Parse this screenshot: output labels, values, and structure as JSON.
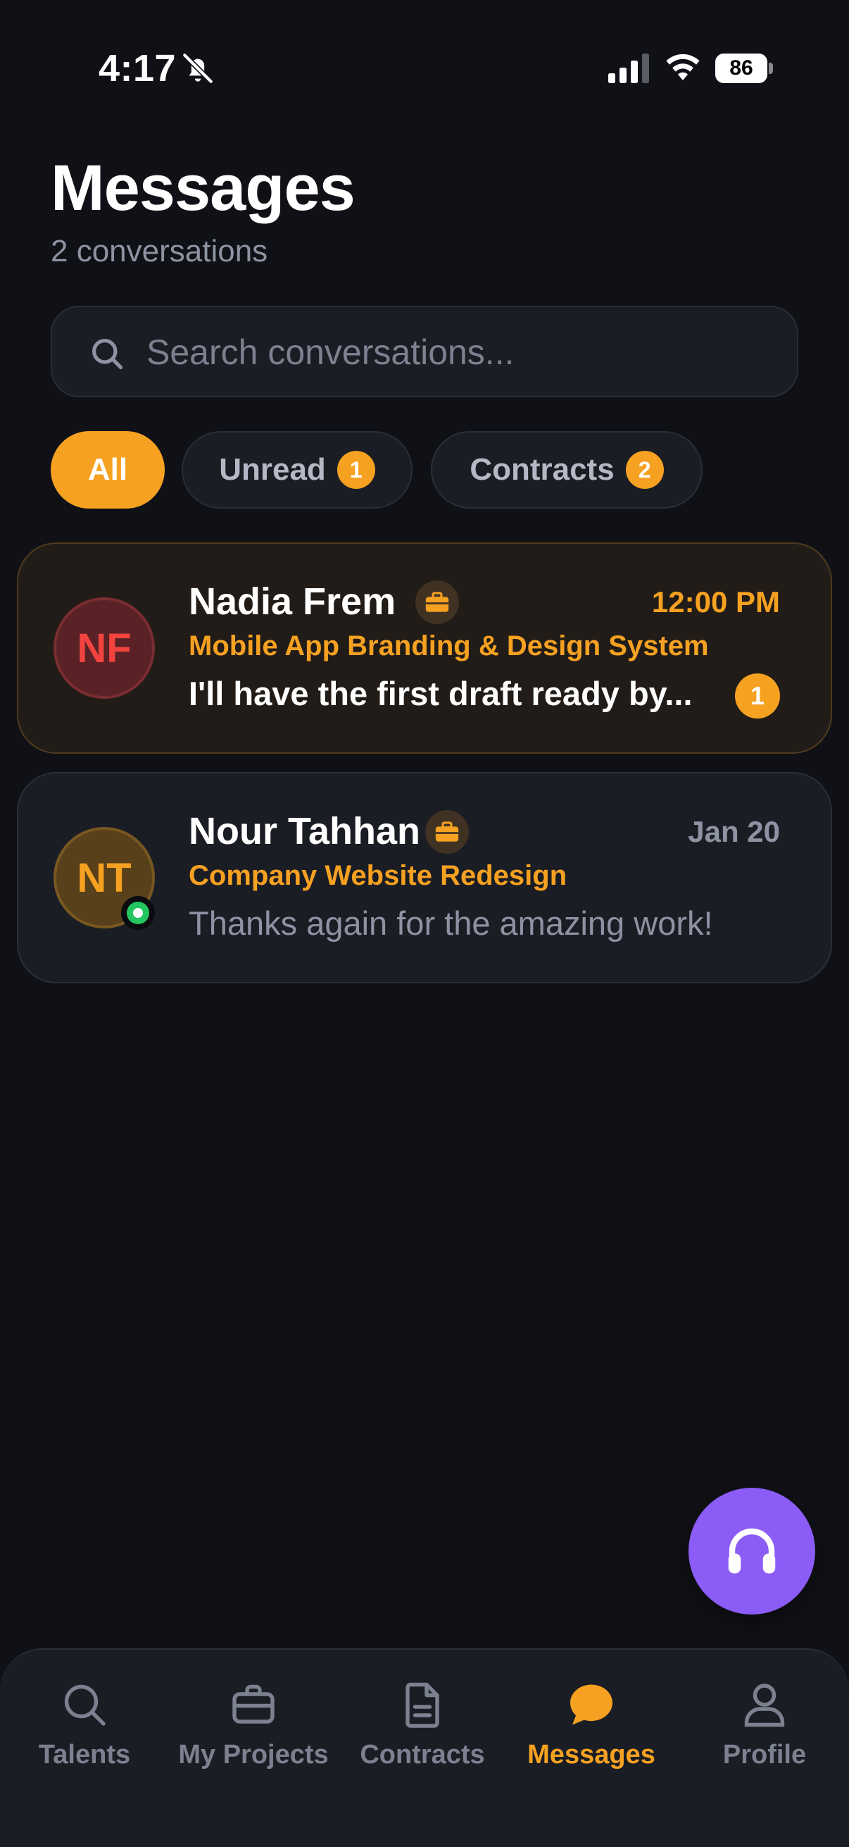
{
  "status_bar": {
    "time": "4:17",
    "battery": "86"
  },
  "header": {
    "title": "Messages",
    "subtitle": "2 conversations"
  },
  "search": {
    "placeholder": "Search conversations..."
  },
  "filters": [
    {
      "label": "All",
      "count": null,
      "active": true
    },
    {
      "label": "Unread",
      "count": "1",
      "active": false
    },
    {
      "label": "Contracts",
      "count": "2",
      "active": false
    }
  ],
  "conversations": [
    {
      "initials": "NF",
      "name": "Nadia Frem",
      "time": "12:00 PM",
      "project": "Mobile App Branding & Design System",
      "preview": "I'll have the first draft ready by...",
      "unread": "1",
      "online": false
    },
    {
      "initials": "NT",
      "name": "Nour Tahhan",
      "time": "Jan 20",
      "project": "Company Website Redesign",
      "preview": "Thanks again for the amazing work!",
      "unread": null,
      "online": true
    }
  ],
  "tabs": [
    {
      "label": "Talents",
      "icon": "search-icon"
    },
    {
      "label": "My Projects",
      "icon": "briefcase-icon"
    },
    {
      "label": "Contracts",
      "icon": "document-icon"
    },
    {
      "label": "Messages",
      "icon": "chat-bubble-icon",
      "active": true
    },
    {
      "label": "Profile",
      "icon": "user-icon"
    }
  ],
  "colors": {
    "background": "#101116",
    "accent": "#f6a121",
    "support": "#8b5cf6",
    "card": "#1b1d24",
    "muted_text": "#8d93a2"
  }
}
